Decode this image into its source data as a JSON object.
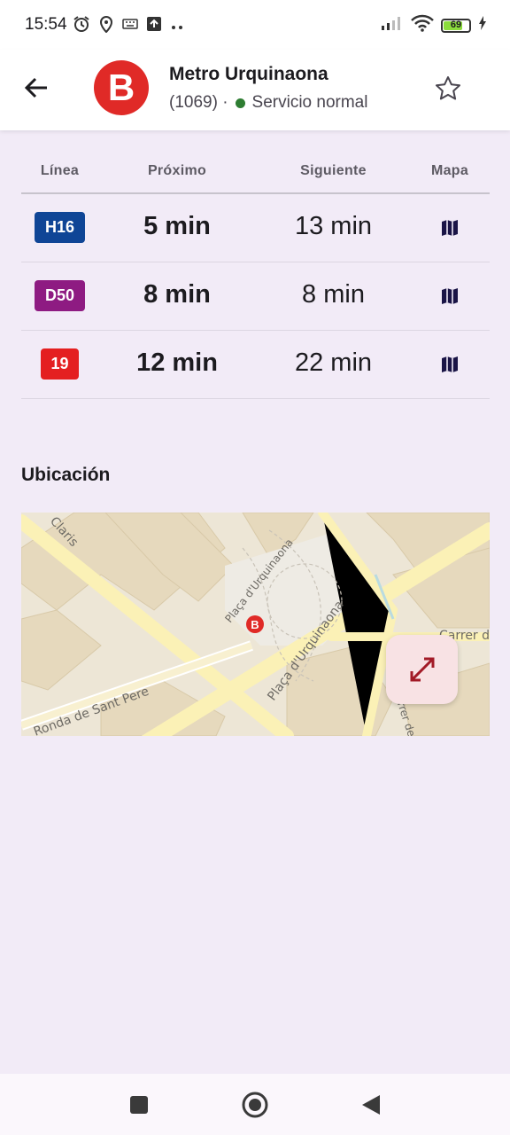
{
  "status_bar": {
    "time": "15:54",
    "battery": "69",
    "icons": [
      "alarm-icon",
      "location-icon",
      "keyboard-icon",
      "upload-icon",
      "more-dots-icon",
      "signal-icon",
      "wifi-icon",
      "battery-icon",
      "charging-icon"
    ]
  },
  "header": {
    "back_icon": "arrow-back-icon",
    "line_logo": "B",
    "stop_name": "Metro Urquinaona",
    "stop_code": "(1069) ·",
    "service_status": "Servicio normal",
    "favorite_icon": "star-outline-icon"
  },
  "table": {
    "headers": {
      "line": "Línea",
      "next": "Próximo",
      "following": "Siguiente",
      "map": "Mapa"
    },
    "rows": [
      {
        "line": "H16",
        "color": "#0f4596",
        "next": "5 min",
        "following": "13 min",
        "map_icon": "map-icon"
      },
      {
        "line": "D50",
        "color": "#8e1b82",
        "next": "8 min",
        "following": "8 min",
        "map_icon": "map-icon"
      },
      {
        "line": "19",
        "color": "#e41f20",
        "next": "12 min",
        "following": "22 min",
        "map_icon": "map-icon"
      }
    ]
  },
  "location": {
    "title": "Ubicación",
    "map_labels": {
      "street_claris": "Claris",
      "placa_urquinaona_1": "Plaça d'Urquinaona",
      "placa_urquinaona_2": "Plaça d'Urquinaona",
      "ronda": "Ronda de Sant Pere",
      "carrer_fontanella": "Carrer de T",
      "carrer_les": "Carrer de les J"
    },
    "marker": "B",
    "expand_icon": "expand-icon"
  },
  "nav_bar": {
    "icons": [
      "recent-apps-icon",
      "home-icon",
      "back-triangle-icon"
    ]
  },
  "colors": {
    "accent": "#e02a27",
    "background": "#f2ebf7",
    "status_ok": "#2e7d32"
  }
}
